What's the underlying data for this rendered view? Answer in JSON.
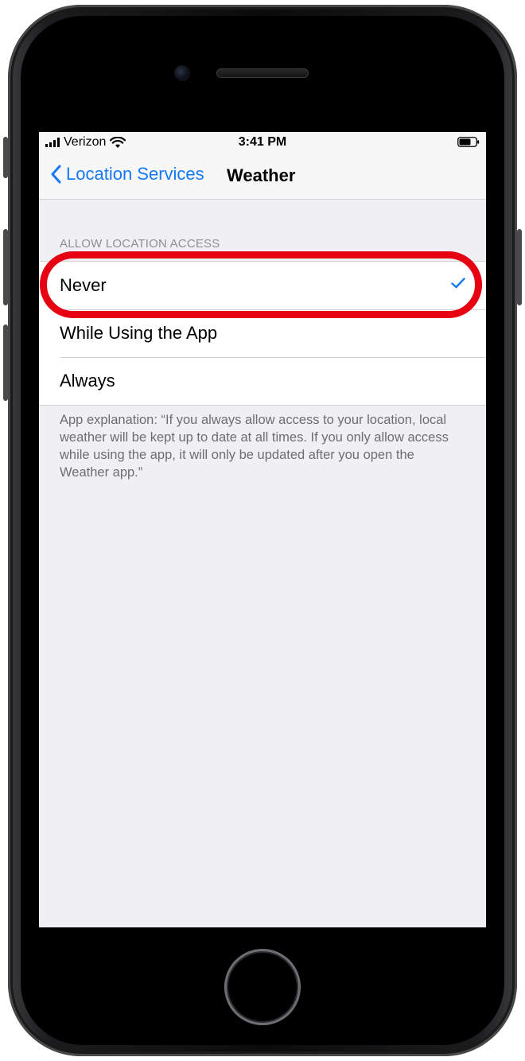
{
  "status_bar": {
    "carrier": "Verizon",
    "time": "3:41 PM"
  },
  "nav": {
    "back_label": "Location Services",
    "title": "Weather"
  },
  "section": {
    "header": "ALLOW LOCATION ACCESS",
    "options": [
      {
        "label": "Never",
        "selected": true
      },
      {
        "label": "While Using the App",
        "selected": false
      },
      {
        "label": "Always",
        "selected": false
      }
    ],
    "footer": "App explanation: “If you always allow access to your location, local weather will be kept up to date at all times. If you only allow access while using the app, it will only be updated after you open the Weather app.”"
  },
  "icons": {
    "signal": "signal-bars-icon",
    "wifi": "wifi-icon",
    "battery": "battery-icon",
    "back": "chevron-left-icon",
    "check": "checkmark-icon"
  },
  "colors": {
    "accent": "#1479f5",
    "highlight": "#e60012",
    "background": "#efeff4"
  }
}
